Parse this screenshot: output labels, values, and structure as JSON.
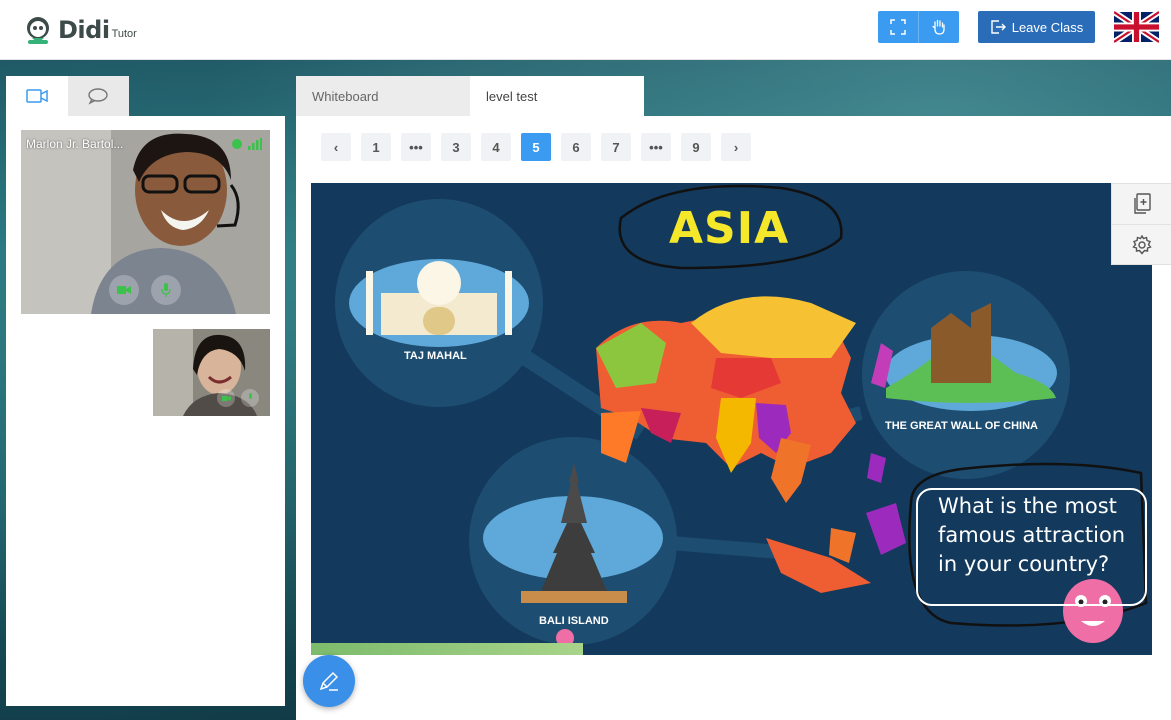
{
  "header": {
    "logo_text": "Didi",
    "logo_sub": "Tutor",
    "leave_label": "Leave Class",
    "icons": [
      "fullscreen-icon",
      "hand-icon",
      "logout-icon",
      "uk-flag"
    ]
  },
  "left_panel": {
    "tabs": [
      {
        "icon": "video-camera-icon",
        "active": true
      },
      {
        "icon": "chat-icon",
        "active": false
      }
    ],
    "videos": [
      {
        "name": "Marlon Jr. Bartol...",
        "camera_on": true,
        "mic_on": true
      },
      {
        "name": "",
        "camera_on": true,
        "mic_on": true
      }
    ]
  },
  "board": {
    "tabs": [
      {
        "label": "Whiteboard",
        "active": false
      },
      {
        "label": "level test",
        "active": true
      }
    ],
    "pagination": {
      "prev": "‹",
      "next": "›",
      "pages": [
        "1",
        "•••",
        "3",
        "4",
        "5",
        "6",
        "7",
        "•••",
        "9"
      ],
      "current": "5"
    },
    "slide": {
      "title": "ASIA",
      "labels": {
        "taj": "TAJ MAHAL",
        "wall": "THE GREAT WALL OF CHINA",
        "bali": "BALI ISLAND"
      },
      "question": "What is the most famous attraction in your country?"
    },
    "side_tools": [
      "copy-add-icon",
      "settings-icon"
    ]
  },
  "colors": {
    "primary": "#3a9bf0",
    "leave": "#2a6cb8",
    "slide_bg": "#13395c",
    "title_yellow": "#f5e82a"
  }
}
